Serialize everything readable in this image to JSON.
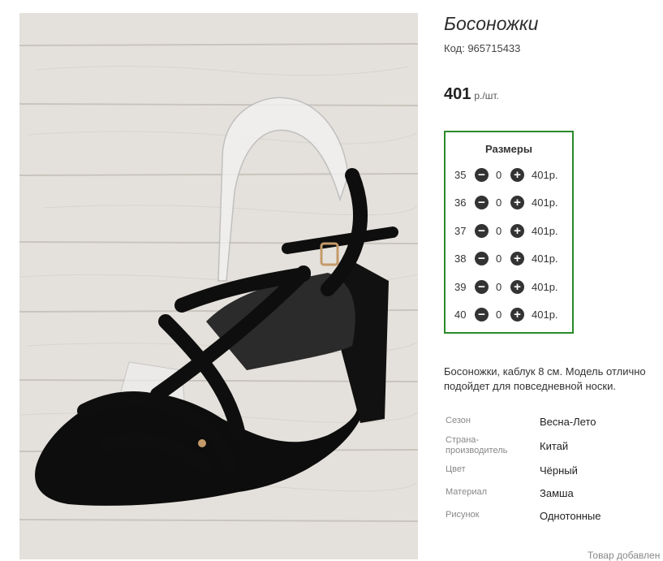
{
  "product": {
    "title": "Босоножки",
    "code": "Код: 965715433",
    "price": "401",
    "price_unit": "р./шт.",
    "image_alt": "Black suede strappy heeled sandal on plastic stand"
  },
  "sizes": {
    "title": "Размеры",
    "rows": [
      {
        "size": "35",
        "qty": "0",
        "price": "401р."
      },
      {
        "size": "36",
        "qty": "0",
        "price": "401р."
      },
      {
        "size": "37",
        "qty": "0",
        "price": "401р."
      },
      {
        "size": "38",
        "qty": "0",
        "price": "401р."
      },
      {
        "size": "39",
        "qty": "0",
        "price": "401р."
      },
      {
        "size": "40",
        "qty": "0",
        "price": "401р."
      }
    ],
    "minus_icon": "−",
    "plus_icon": "+"
  },
  "description": "Босоножки, каблук 8 см. Модель отлично подойдет для повседневной носки.",
  "properties": [
    {
      "key": "Сезон",
      "value": "Весна-Лето"
    },
    {
      "key": "Страна-производитель",
      "value": "Китай"
    },
    {
      "key": "Цвет",
      "value": "Чёрный"
    },
    {
      "key": "Материал",
      "value": "Замша"
    },
    {
      "key": "Рисунок",
      "value": "Однотонные"
    }
  ],
  "footer": {
    "added_text": "Товар добавлен"
  },
  "colors": {
    "accent_border": "#2b8a2b",
    "button_dark": "#333333"
  }
}
